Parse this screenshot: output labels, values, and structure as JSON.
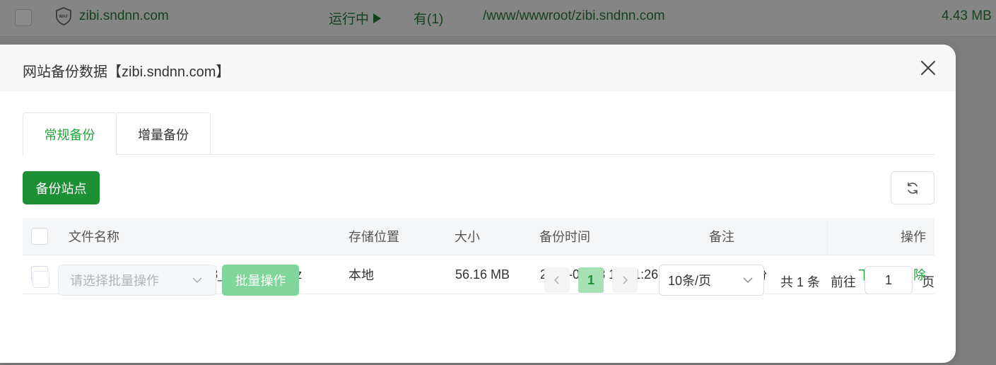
{
  "background_row": {
    "waf_icon_text": "WAF",
    "site_name": "zibi.sndnn.com",
    "status": "运行中",
    "backup": "有(1)",
    "path": "/www/wwwroot/zibi.sndnn.com",
    "size": "4.43 MB"
  },
  "dialog": {
    "title": "网站备份数据【zibi.sndnn.com】",
    "tabs": [
      {
        "label": "常规备份",
        "active": true
      },
      {
        "label": "增量备份",
        "active": false
      }
    ],
    "backup_button": "备份站点",
    "table": {
      "headers": {
        "filename": "文件名称",
        "storage": "存储位置",
        "size": "大小",
        "time": "备份时间",
        "note": "备注",
        "action": "操作"
      },
      "rows": [
        {
          "filename": "zibi.sndnn.com_20260508_150126.tar.gz",
          "storage": "本地",
          "size": "56.16 MB",
          "time": "2026-05-08 15:01:26",
          "note": "手动备份",
          "download": "下载",
          "delete": "删除"
        }
      ]
    },
    "footer": {
      "batch_placeholder": "请选择批量操作",
      "batch_button": "批量操作",
      "current_page": "1",
      "page_size": "10条/页",
      "total": "共 1 条",
      "goto_label": "前往",
      "goto_value": "1",
      "page_suffix": "页"
    }
  },
  "colors": {
    "accent": "#20a53a",
    "primary_button": "#1d8f35",
    "disabled_button": "#7fd59a"
  }
}
